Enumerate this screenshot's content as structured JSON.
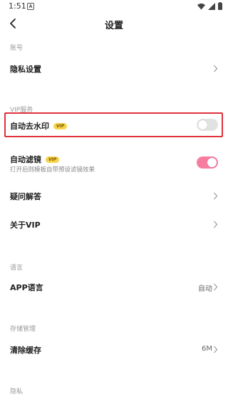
{
  "status_bar": {
    "time": "1:51"
  },
  "header": {
    "title": "设置"
  },
  "sections": {
    "account": "账号",
    "vip_service": "VIP服务",
    "language": "语言",
    "storage": "存储管理",
    "privacy": "隐私"
  },
  "rows": {
    "privacy_settings": {
      "label": "隐私设置"
    },
    "auto_watermark": {
      "label": "自动去水印",
      "badge": "VIP",
      "enabled": false
    },
    "auto_filter": {
      "label": "自动滤镜",
      "badge": "VIP",
      "desc": "打开后则模板自带预设滤镜效果",
      "enabled": true
    },
    "faq": {
      "label": "疑问解答"
    },
    "about_vip": {
      "label": "关于VIP"
    },
    "app_language": {
      "label": "APP语言",
      "value": "自动"
    },
    "clear_cache": {
      "label": "清除缓存",
      "value": "6M"
    }
  },
  "colors": {
    "highlight": "#e0303a",
    "toggle_on": "#f67ca0",
    "vip_badge": "#f7d24a"
  }
}
